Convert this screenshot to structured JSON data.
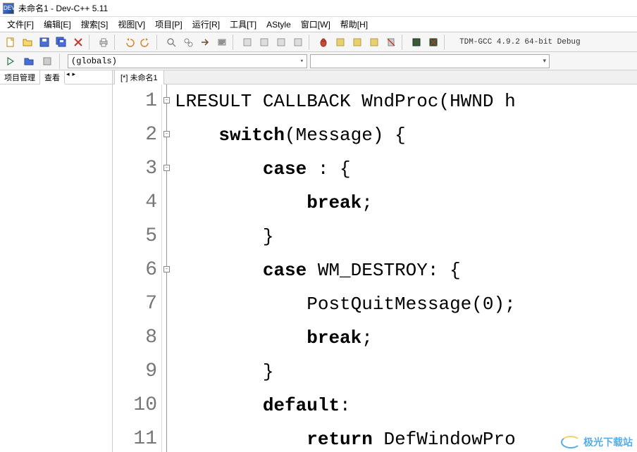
{
  "titlebar": {
    "app_icon_text": "DEV",
    "title": "未命名1 - Dev-C++ 5.11"
  },
  "menubar": {
    "items": [
      {
        "label": "文件[F]"
      },
      {
        "label": "编辑[E]"
      },
      {
        "label": "搜索[S]"
      },
      {
        "label": "视图[V]"
      },
      {
        "label": "项目[P]"
      },
      {
        "label": "运行[R]"
      },
      {
        "label": "工具[T]"
      },
      {
        "label": "AStyle"
      },
      {
        "label": "窗口[W]"
      },
      {
        "label": "帮助[H]"
      }
    ]
  },
  "toolbar": {
    "compiler_label": "TDM-GCC 4.9.2 64-bit Debug"
  },
  "toolbar2": {
    "scope_value": "(globals)"
  },
  "sidebar": {
    "tabs": [
      {
        "label": "项目管理"
      },
      {
        "label": "查看"
      }
    ],
    "nav_left": "◂",
    "nav_right": "▸"
  },
  "editor": {
    "tab_label": "[*] 未命名1",
    "lines": [
      {
        "n": "1",
        "indent": 0,
        "tokens": [
          [
            "",
            "LRESULT CALLBACK WndProc(HWND h"
          ]
        ],
        "fold": true
      },
      {
        "n": "2",
        "indent": 1,
        "tokens": [
          [
            "kw",
            "switch"
          ],
          [
            "",
            "(Message) {"
          ]
        ],
        "fold": true
      },
      {
        "n": "3",
        "indent": 2,
        "tokens": [
          [
            "kw",
            "case"
          ],
          [
            "",
            " : {"
          ]
        ],
        "fold": true
      },
      {
        "n": "4",
        "indent": 3,
        "tokens": [
          [
            "kw",
            "break"
          ],
          [
            "",
            ";"
          ]
        ]
      },
      {
        "n": "5",
        "indent": 2,
        "tokens": [
          [
            "",
            "}"
          ]
        ]
      },
      {
        "n": "6",
        "indent": 2,
        "tokens": [
          [
            "kw",
            "case"
          ],
          [
            "",
            " WM_DESTROY: {"
          ]
        ],
        "fold": true
      },
      {
        "n": "7",
        "indent": 3,
        "tokens": [
          [
            "",
            "PostQuitMessage(0);"
          ]
        ]
      },
      {
        "n": "8",
        "indent": 3,
        "tokens": [
          [
            "kw",
            "break"
          ],
          [
            "",
            ";"
          ]
        ]
      },
      {
        "n": "9",
        "indent": 2,
        "tokens": [
          [
            "",
            "}"
          ]
        ]
      },
      {
        "n": "10",
        "indent": 2,
        "tokens": [
          [
            "kw",
            "default"
          ],
          [
            "",
            ":"
          ]
        ]
      },
      {
        "n": "11",
        "indent": 3,
        "tokens": [
          [
            "kw",
            "return"
          ],
          [
            "",
            " DefWindowPro"
          ]
        ]
      }
    ]
  },
  "watermark": {
    "text": "极光下载站"
  }
}
